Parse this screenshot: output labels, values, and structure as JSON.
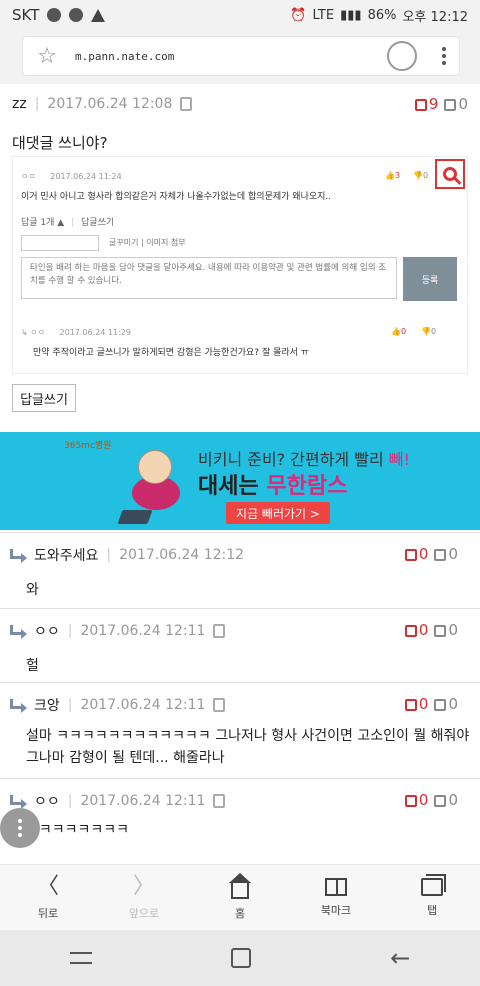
{
  "statusbar": {
    "carrier": "SKT",
    "network": "LTE",
    "battery": "86%",
    "time": "오후 12:12"
  },
  "browser": {
    "url": "m.pann.nate.com"
  },
  "post": {
    "author": "zz",
    "date": "2017.06.24 12:08",
    "up": "9",
    "down": "0",
    "text": "대댓글 쓰니야?"
  },
  "embed": {
    "comment1_author": "ㅇㅇ",
    "comment1_date": "2017.06.24 11:24",
    "comment1_up": "3",
    "comment1_down": "0",
    "comment1_text": "이거 민사 아니고 형사라 합의같은거 자체가 나올수가없는데 합의문제가 왜나오지..",
    "reply_count": "답글 1개",
    "write_reply": "답글쓰기",
    "emoticon": "글꾸미기",
    "attach": "이미지 첨부",
    "placeholder": "타인을 배려 하는 마음을 담아 댓글을 달아주세요. 내용에 따라 이용약관 및 관련 법률에 의해 임의 조치를 수행 할 수 있습니다.",
    "submit": "등록",
    "comment2_author": "ㅇㅇ",
    "comment2_date": "2017.06.24 11:29",
    "comment2_up": "0",
    "comment2_down": "0",
    "comment2_text": "만약 주작이라고 글쓰니가 말하게되면 감형은 가능한건가요? 잘 몰라서 ㅠ"
  },
  "reply_button": "답글쓰기",
  "ad": {
    "logo": "365mc병원",
    "line1a": "비키니 준비? 간편하게 빨리 ",
    "line1b": "빼!",
    "line2a": "대세는 ",
    "line2b": "무한람스",
    "button": "지금 빼러가기 >"
  },
  "comments": [
    {
      "author": "도와주세요",
      "date": "2017.06.24 12:12",
      "up": "0",
      "down": "0",
      "text": "와"
    },
    {
      "author": "ㅇㅇ",
      "date": "2017.06.24 12:11",
      "up": "0",
      "down": "0",
      "text": "헐"
    },
    {
      "author": "크앙",
      "date": "2017.06.24 12:11",
      "up": "0",
      "down": "0",
      "text": "설마 ㅋㅋㅋㅋㅋㅋㅋㅋㅋㅋㅋㅋ 그나저나 형사 사건이면 고소인이 뭘 해줘야 그나마 감형이 될 텐데... 해줄라나"
    },
    {
      "author": "ㅇㅇ",
      "date": "2017.06.24 12:11",
      "up": "0",
      "down": "0",
      "text": "헐ㅋㅋㅋㅋㅋㅋㅋ"
    }
  ],
  "nav": {
    "back": "뒤로",
    "forward": "앞으로",
    "home": "홈",
    "bookmarks": "북마크",
    "tabs": "탭"
  },
  "colors": {
    "accent_red": "#d03030",
    "ad_bg": "#23bfe0",
    "submit_bg": "#7f8f9a"
  }
}
